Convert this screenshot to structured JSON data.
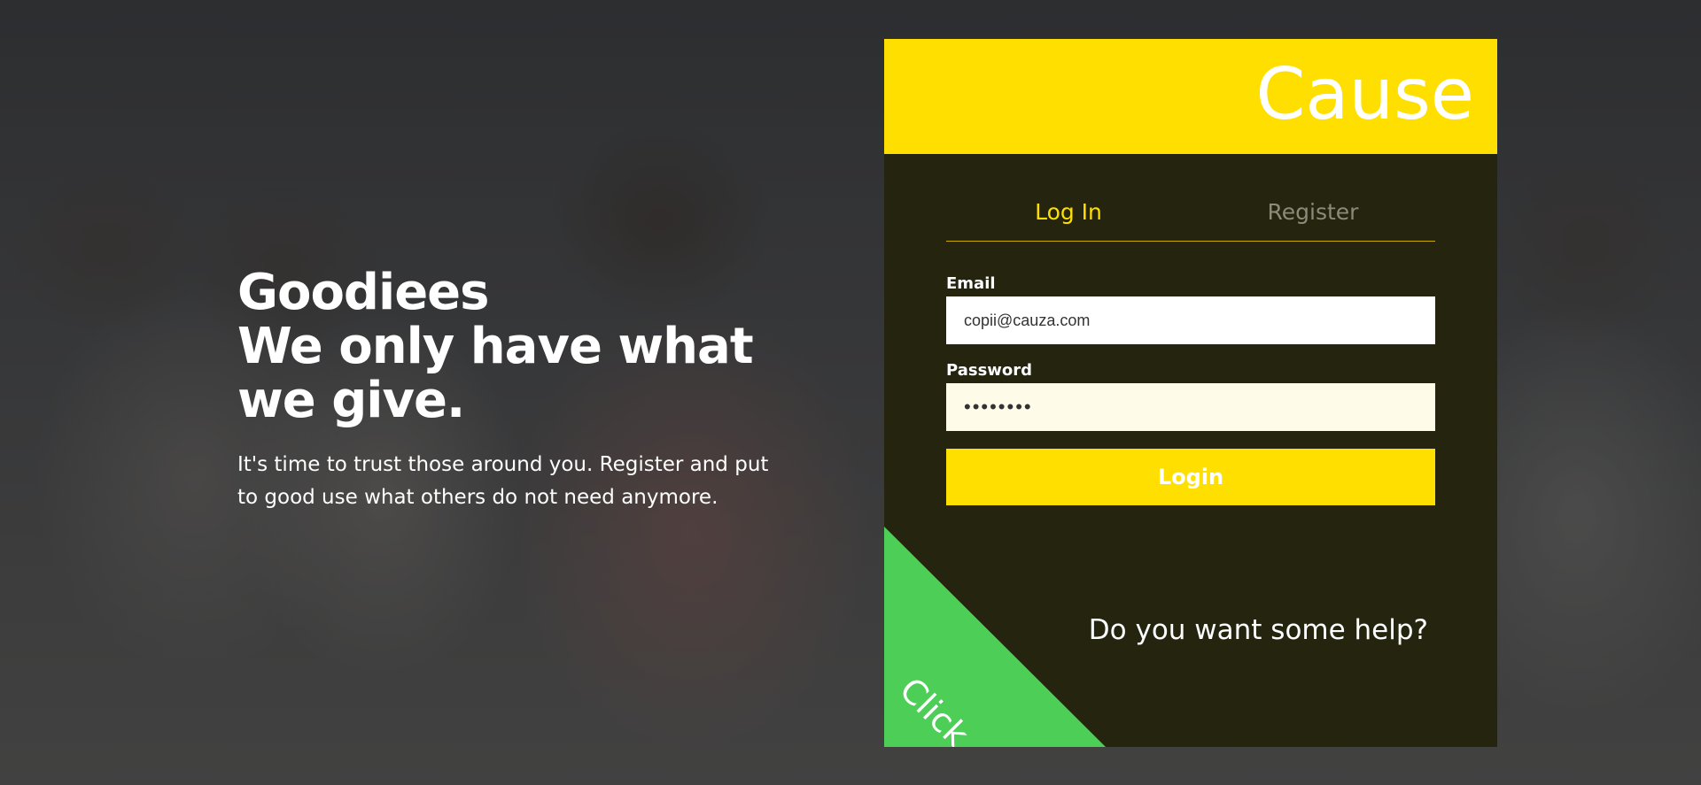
{
  "hero": {
    "title_line1": "Goodiees",
    "title_line2": "We only have what",
    "title_line3": "we give.",
    "subtitle": "It's time to trust those around you. Register and put to good use what others do not need anymore."
  },
  "card": {
    "brand": "Cause",
    "tabs": [
      {
        "label": "Log In",
        "active": true
      },
      {
        "label": "Register",
        "active": false
      }
    ],
    "email": {
      "label": "Email",
      "value": "copii@cauza.com"
    },
    "password": {
      "label": "Password",
      "value": "••••••••"
    },
    "login_label": "Login",
    "help_text": "Do you want some help?",
    "click_label": "Click"
  },
  "colors": {
    "accent_yellow": "#ffdf00",
    "card_bg": "#24240f",
    "click_green": "#4cce57",
    "password_bg": "#fefce8"
  }
}
